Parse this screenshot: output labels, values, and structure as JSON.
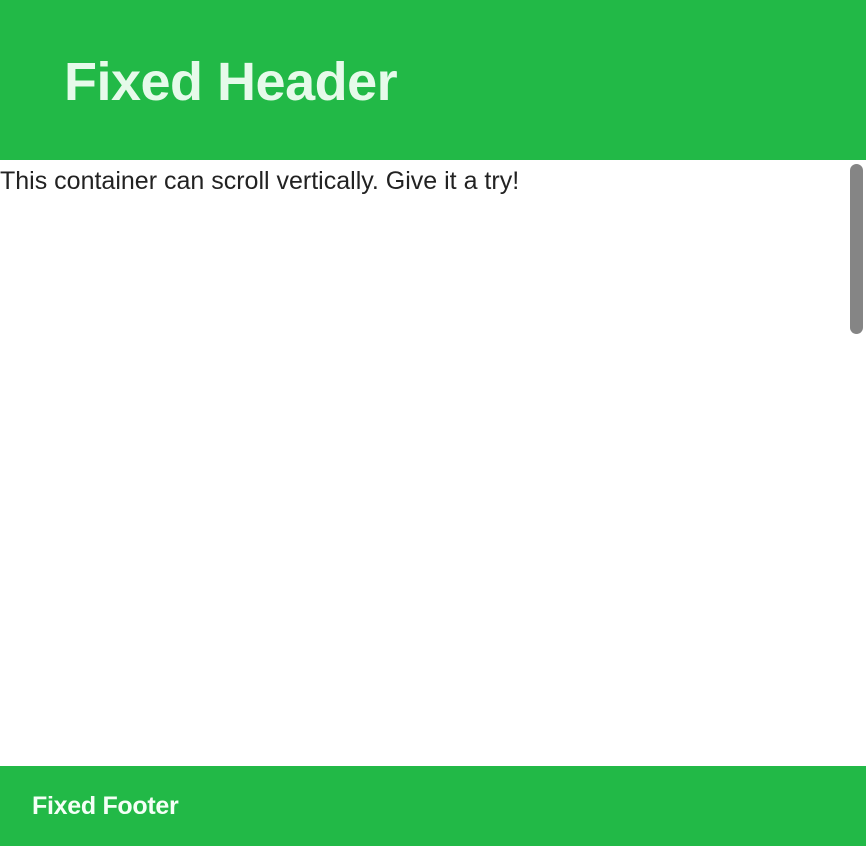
{
  "header": {
    "title": "Fixed Header"
  },
  "content": {
    "text": "This container can scroll vertically. Give it a try!"
  },
  "footer": {
    "title": "Fixed Footer"
  },
  "colors": {
    "accent": "#22b947",
    "header_text": "#e6faea",
    "body_text": "#222222",
    "scrollbar_thumb": "#858585"
  }
}
